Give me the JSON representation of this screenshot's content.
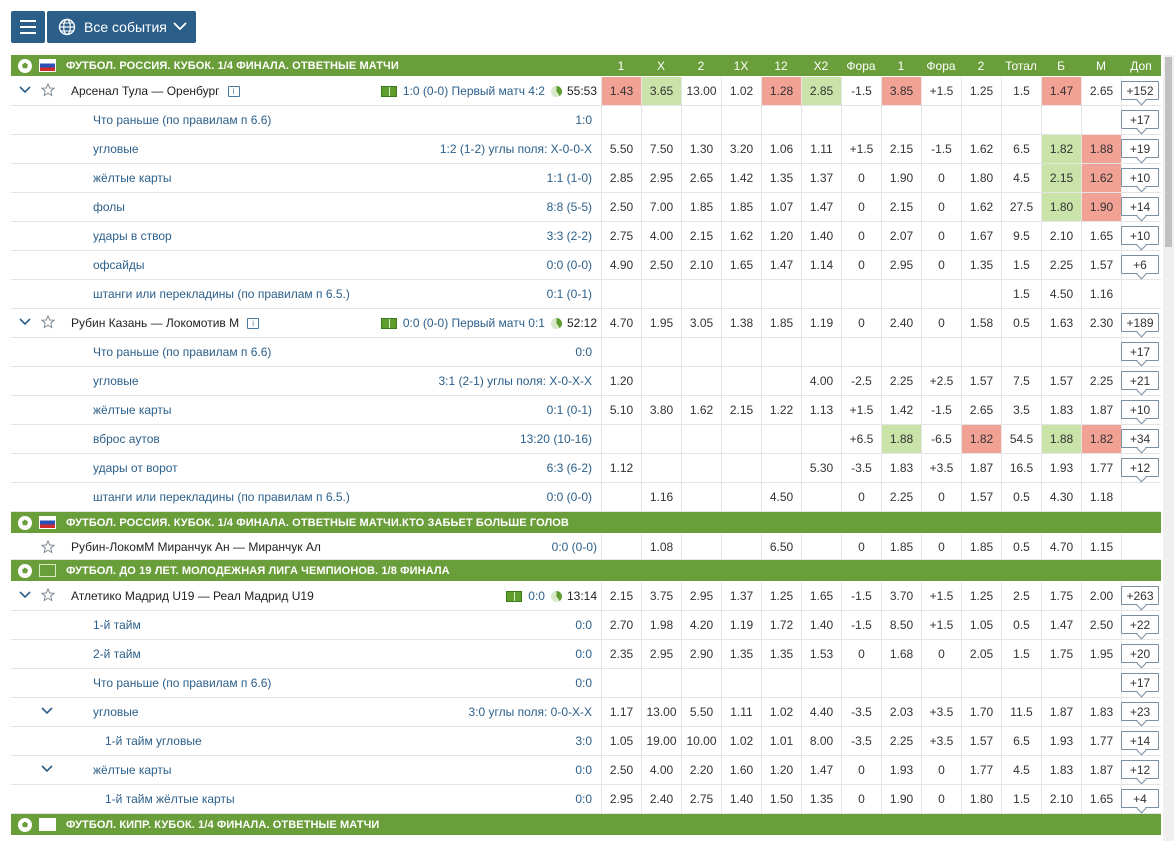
{
  "topbar": {
    "events_label": "Все события"
  },
  "columns": [
    "1",
    "X",
    "2",
    "1X",
    "12",
    "X2",
    "Фора",
    "1",
    "Фора",
    "2",
    "Тотал",
    "Б",
    "М",
    "Доп"
  ],
  "colors": {
    "league_bar": "#6a9e3a",
    "highlight_red": "#f2a195",
    "highlight_green": "#c9e3a8",
    "brand": "#2b5f8a"
  },
  "rows": [
    {
      "kind": "league",
      "flag": "ru",
      "title": "ФУТБОЛ. РОССИЯ. КУБОК. 1/4 ФИНАЛА. ОТВЕТНЫЕ МАТЧИ"
    },
    {
      "kind": "event",
      "name": "Арсенал Тула — Оренбург",
      "info": true,
      "field": true,
      "score": "1:0  (0-0) Первый матч 4:2",
      "clock": true,
      "time": "55:53",
      "odds": [
        "1.43",
        "3.65",
        "13.00",
        "1.02",
        "1.28",
        "2.85",
        "-1.5",
        "3.85",
        "+1.5",
        "1.25",
        "1.5",
        "1.47",
        "2.65"
      ],
      "hl": [
        "r",
        "g",
        "",
        "",
        "r",
        "g",
        "",
        "r",
        "",
        "",
        "",
        "r",
        ""
      ],
      "more": "+152"
    },
    {
      "kind": "sub",
      "name": "Что раньше (по правилам п 6.6)",
      "score": "1:0",
      "odds": [
        "",
        "",
        "",
        "",
        "",
        "",
        "",
        "",
        "",
        "",
        "",
        "",
        ""
      ],
      "hl": [
        "",
        "",
        "",
        "",
        "",
        "",
        "",
        "",
        "",
        "",
        "",
        "",
        ""
      ],
      "more": "+17"
    },
    {
      "kind": "sub",
      "name": "угловые",
      "score": "1:2  (1-2) углы поля: X-0-0-X",
      "odds": [
        "5.50",
        "7.50",
        "1.30",
        "3.20",
        "1.06",
        "1.11",
        "+1.5",
        "2.15",
        "-1.5",
        "1.62",
        "6.5",
        "1.82",
        "1.88"
      ],
      "hl": [
        "",
        "",
        "",
        "",
        "",
        "",
        "",
        "",
        "",
        "",
        "",
        "g",
        "r"
      ],
      "more": "+19"
    },
    {
      "kind": "sub",
      "name": "жёлтые карты",
      "score": "1:1  (1-0)",
      "odds": [
        "2.85",
        "2.95",
        "2.65",
        "1.42",
        "1.35",
        "1.37",
        "0",
        "1.90",
        "0",
        "1.80",
        "4.5",
        "2.15",
        "1.62"
      ],
      "hl": [
        "",
        "",
        "",
        "",
        "",
        "",
        "",
        "",
        "",
        "",
        "",
        "g",
        "r"
      ],
      "more": "+10"
    },
    {
      "kind": "sub",
      "name": "фолы",
      "score": "8:8  (5-5)",
      "odds": [
        "2.50",
        "7.00",
        "1.85",
        "1.85",
        "1.07",
        "1.47",
        "0",
        "2.15",
        "0",
        "1.62",
        "27.5",
        "1.80",
        "1.90"
      ],
      "hl": [
        "",
        "",
        "",
        "",
        "",
        "",
        "",
        "",
        "",
        "",
        "",
        "g",
        "r"
      ],
      "more": "+14"
    },
    {
      "kind": "sub",
      "name": "удары в створ",
      "score": "3:3  (2-2)",
      "odds": [
        "2.75",
        "4.00",
        "2.15",
        "1.62",
        "1.20",
        "1.40",
        "0",
        "2.07",
        "0",
        "1.67",
        "9.5",
        "2.10",
        "1.65"
      ],
      "hl": [
        "",
        "",
        "",
        "",
        "",
        "",
        "",
        "",
        "",
        "",
        "",
        "",
        ""
      ],
      "more": "+10"
    },
    {
      "kind": "sub",
      "name": "офсайды",
      "score": "0:0  (0-0)",
      "odds": [
        "4.90",
        "2.50",
        "2.10",
        "1.65",
        "1.47",
        "1.14",
        "0",
        "2.95",
        "0",
        "1.35",
        "1.5",
        "2.25",
        "1.57"
      ],
      "hl": [
        "",
        "",
        "",
        "",
        "",
        "",
        "",
        "",
        "",
        "",
        "",
        "",
        ""
      ],
      "more": "+6"
    },
    {
      "kind": "sub",
      "name": "штанги или перекладины (по правилам п 6.5.)",
      "score": "0:1  (0-1)",
      "odds": [
        "",
        "",
        "",
        "",
        "",
        "",
        "",
        "",
        "",
        "",
        "1.5",
        "4.50",
        "1.16"
      ],
      "hl": [
        "",
        "",
        "",
        "",
        "",
        "",
        "",
        "",
        "",
        "",
        "",
        "",
        ""
      ],
      "more": ""
    },
    {
      "kind": "event",
      "name": "Рубин Казань — Локомотив М",
      "info": true,
      "field": true,
      "score": "0:0  (0-0) Первый матч 0:1",
      "clock": true,
      "time": "52:12",
      "odds": [
        "4.70",
        "1.95",
        "3.05",
        "1.38",
        "1.85",
        "1.19",
        "0",
        "2.40",
        "0",
        "1.58",
        "0.5",
        "1.63",
        "2.30"
      ],
      "hl": [
        "",
        "",
        "",
        "",
        "",
        "",
        "",
        "",
        "",
        "",
        "",
        "",
        ""
      ],
      "more": "+189"
    },
    {
      "kind": "sub",
      "name": "Что раньше (по правилам п 6.6)",
      "score": "0:0",
      "odds": [
        "",
        "",
        "",
        "",
        "",
        "",
        "",
        "",
        "",
        "",
        "",
        "",
        ""
      ],
      "hl": [
        "",
        "",
        "",
        "",
        "",
        "",
        "",
        "",
        "",
        "",
        "",
        "",
        ""
      ],
      "more": "+17"
    },
    {
      "kind": "sub",
      "name": "угловые",
      "score": "3:1  (2-1) углы поля: X-0-X-X",
      "odds": [
        "1.20",
        "",
        "",
        "",
        "",
        "4.00",
        "-2.5",
        "2.25",
        "+2.5",
        "1.57",
        "7.5",
        "1.57",
        "2.25"
      ],
      "hl": [
        "",
        "",
        "",
        "",
        "",
        "",
        "",
        "",
        "",
        "",
        "",
        "",
        ""
      ],
      "more": "+21"
    },
    {
      "kind": "sub",
      "name": "жёлтые карты",
      "score": "0:1  (0-1)",
      "odds": [
        "5.10",
        "3.80",
        "1.62",
        "2.15",
        "1.22",
        "1.13",
        "+1.5",
        "1.42",
        "-1.5",
        "2.65",
        "3.5",
        "1.83",
        "1.87"
      ],
      "hl": [
        "",
        "",
        "",
        "",
        "",
        "",
        "",
        "",
        "",
        "",
        "",
        "",
        ""
      ],
      "more": "+10"
    },
    {
      "kind": "sub",
      "name": "вброс аутов",
      "score": "13:20  (10-16)",
      "odds": [
        "",
        "",
        "",
        "",
        "",
        "",
        "+6.5",
        "1.88",
        "-6.5",
        "1.82",
        "54.5",
        "1.88",
        "1.82"
      ],
      "hl": [
        "",
        "",
        "",
        "",
        "",
        "",
        "",
        "g",
        "",
        "r",
        "",
        "g",
        "r"
      ],
      "more": "+34"
    },
    {
      "kind": "sub",
      "name": "удары от ворот",
      "score": "6:3  (6-2)",
      "odds": [
        "1.12",
        "",
        "",
        "",
        "",
        "5.30",
        "-3.5",
        "1.83",
        "+3.5",
        "1.87",
        "16.5",
        "1.93",
        "1.77"
      ],
      "hl": [
        "",
        "",
        "",
        "",
        "",
        "",
        "",
        "",
        "",
        "",
        "",
        "",
        ""
      ],
      "more": "+12"
    },
    {
      "kind": "sub",
      "name": "штанги или перекладины (по правилам п 6.5.)",
      "score": "0:0  (0-0)",
      "odds": [
        "",
        "1.16",
        "",
        "",
        "4.50",
        "",
        "0",
        "2.25",
        "0",
        "1.57",
        "0.5",
        "4.30",
        "1.18"
      ],
      "hl": [
        "",
        "",
        "",
        "",
        "",
        "",
        "",
        "",
        "",
        "",
        "",
        "",
        ""
      ],
      "more": ""
    },
    {
      "kind": "league",
      "flag": "ru",
      "title": "ФУТБОЛ. РОССИЯ. КУБОК. 1/4 ФИНАЛА. ОТВЕТНЫЕ МАТЧИ.КТО ЗАБЬЕТ БОЛЬШЕ ГОЛОВ"
    },
    {
      "kind": "event",
      "short": true,
      "nochev": true,
      "name": "Рубин-ЛокомМ Миранчук Ан — Миранчук Ал",
      "score": "0:0  (0-0)",
      "odds": [
        "",
        "1.08",
        "",
        "",
        "6.50",
        "",
        "0",
        "1.85",
        "0",
        "1.85",
        "0.5",
        "4.70",
        "1.15"
      ],
      "hl": [
        "",
        "",
        "",
        "",
        "",
        "",
        "",
        "",
        "",
        "",
        "",
        "",
        ""
      ],
      "more": ""
    },
    {
      "kind": "league",
      "flag": "eu",
      "title": "ФУТБОЛ. ДО 19 ЛЕТ. МОЛОДЕЖНАЯ ЛИГА ЧЕМПИОНОВ. 1/8 ФИНАЛА"
    },
    {
      "kind": "event",
      "name": "Атлетико Мадрид U19 — Реал Мадрид U19",
      "field": true,
      "score": "0:0",
      "clock": true,
      "time": "13:14",
      "odds": [
        "2.15",
        "3.75",
        "2.95",
        "1.37",
        "1.25",
        "1.65",
        "-1.5",
        "3.70",
        "+1.5",
        "1.25",
        "2.5",
        "1.75",
        "2.00"
      ],
      "hl": [
        "",
        "",
        "",
        "",
        "",
        "",
        "",
        "",
        "",
        "",
        "",
        "",
        ""
      ],
      "more": "+263"
    },
    {
      "kind": "sub",
      "name": "1-й тайм",
      "score": "0:0",
      "odds": [
        "2.70",
        "1.98",
        "4.20",
        "1.19",
        "1.72",
        "1.40",
        "-1.5",
        "8.50",
        "+1.5",
        "1.05",
        "0.5",
        "1.47",
        "2.50"
      ],
      "hl": [
        "",
        "",
        "",
        "",
        "",
        "",
        "",
        "",
        "",
        "",
        "",
        "",
        ""
      ],
      "more": "+22"
    },
    {
      "kind": "sub",
      "name": "2-й тайм",
      "score": "0:0",
      "odds": [
        "2.35",
        "2.95",
        "2.90",
        "1.35",
        "1.35",
        "1.53",
        "0",
        "1.68",
        "0",
        "2.05",
        "1.5",
        "1.75",
        "1.95"
      ],
      "hl": [
        "",
        "",
        "",
        "",
        "",
        "",
        "",
        "",
        "",
        "",
        "",
        "",
        ""
      ],
      "more": "+20"
    },
    {
      "kind": "sub",
      "name": "Что раньше (по правилам п 6.6)",
      "score": "0:0",
      "odds": [
        "",
        "",
        "",
        "",
        "",
        "",
        "",
        "",
        "",
        "",
        "",
        "",
        ""
      ],
      "hl": [
        "",
        "",
        "",
        "",
        "",
        "",
        "",
        "",
        "",
        "",
        "",
        "",
        ""
      ],
      "more": "+17"
    },
    {
      "kind": "sub",
      "chev": true,
      "name": "угловые",
      "score": "3:0  углы поля: 0-0-X-X",
      "odds": [
        "1.17",
        "13.00",
        "5.50",
        "1.11",
        "1.02",
        "4.40",
        "-3.5",
        "2.03",
        "+3.5",
        "1.70",
        "11.5",
        "1.87",
        "1.83"
      ],
      "hl": [
        "",
        "",
        "",
        "",
        "",
        "",
        "",
        "",
        "",
        "",
        "",
        "",
        ""
      ],
      "more": "+23"
    },
    {
      "kind": "sub",
      "deep": true,
      "name": "1-й тайм угловые",
      "score": "3:0",
      "odds": [
        "1.05",
        "19.00",
        "10.00",
        "1.02",
        "1.01",
        "8.00",
        "-3.5",
        "2.25",
        "+3.5",
        "1.57",
        "6.5",
        "1.93",
        "1.77"
      ],
      "hl": [
        "",
        "",
        "",
        "",
        "",
        "",
        "",
        "",
        "",
        "",
        "",
        "",
        ""
      ],
      "more": "+14"
    },
    {
      "kind": "sub",
      "chev": true,
      "name": "жёлтые карты",
      "score": "0:0",
      "odds": [
        "2.50",
        "4.00",
        "2.20",
        "1.60",
        "1.20",
        "1.47",
        "0",
        "1.93",
        "0",
        "1.77",
        "4.5",
        "1.83",
        "1.87"
      ],
      "hl": [
        "",
        "",
        "",
        "",
        "",
        "",
        "",
        "",
        "",
        "",
        "",
        "",
        ""
      ],
      "more": "+12"
    },
    {
      "kind": "sub",
      "deep": true,
      "name": "1-й тайм жёлтые карты",
      "score": "0:0",
      "odds": [
        "2.95",
        "2.40",
        "2.75",
        "1.40",
        "1.50",
        "1.35",
        "0",
        "1.90",
        "0",
        "1.80",
        "1.5",
        "2.10",
        "1.65"
      ],
      "hl": [
        "",
        "",
        "",
        "",
        "",
        "",
        "",
        "",
        "",
        "",
        "",
        "",
        ""
      ],
      "more": "+4"
    },
    {
      "kind": "league",
      "flag": "cy",
      "title": "ФУТБОЛ. КИПР. КУБОК. 1/4 ФИНАЛА. ОТВЕТНЫЕ МАТЧИ"
    }
  ]
}
